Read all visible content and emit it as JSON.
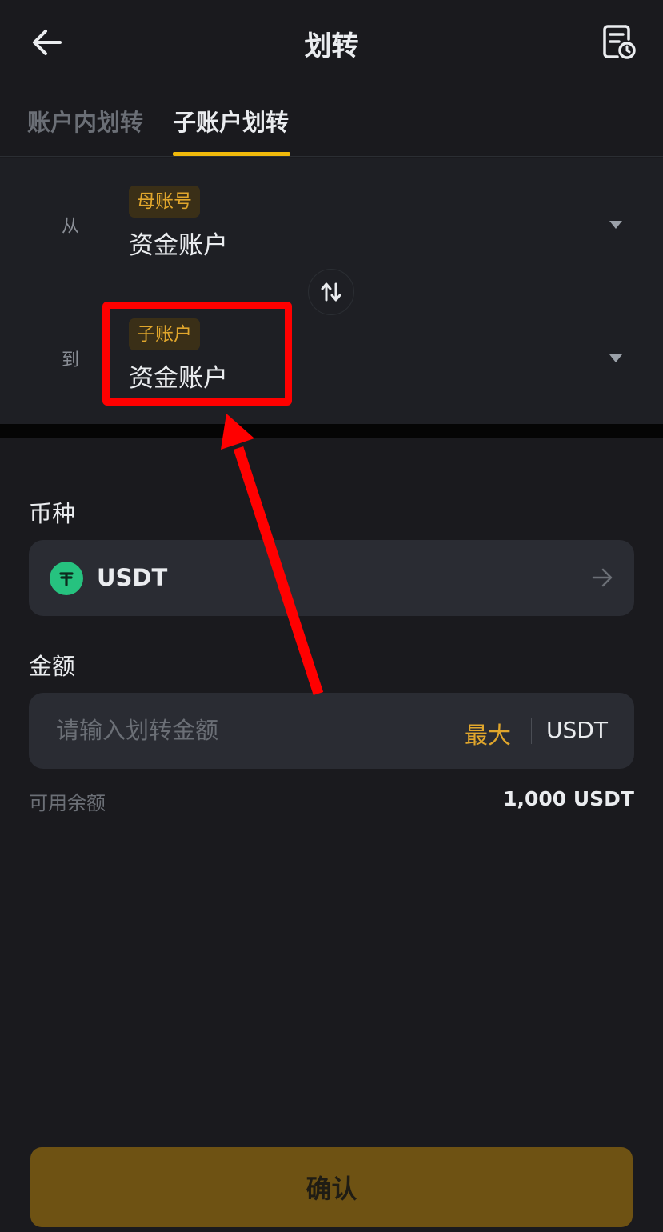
{
  "header": {
    "title": "划转",
    "back_icon": "arrow-left-icon",
    "history_icon": "history-record-icon"
  },
  "tabs": [
    {
      "label": "账户内划转",
      "active": false
    },
    {
      "label": "子账户划转",
      "active": true
    }
  ],
  "transfer": {
    "from": {
      "label": "从",
      "badge": "母账号",
      "account": "资金账户"
    },
    "to": {
      "label": "到",
      "badge": "子账户",
      "account": "资金账户"
    },
    "swap_icon": "swap-vertical-icon"
  },
  "coin": {
    "label": "币种",
    "symbol": "USDT",
    "icon": "tether-icon"
  },
  "amount": {
    "label": "金额",
    "placeholder": "请输入划转金额",
    "max_label": "最大",
    "unit": "USDT"
  },
  "available": {
    "label": "可用余额",
    "value": "1,000 USDT"
  },
  "confirm_label": "确认",
  "colors": {
    "background": "#1a1a1e",
    "accent": "#f0b90b",
    "badge_text": "#e0a62c",
    "highlight": "#ff0000",
    "confirm_button": "#6e5213",
    "coin_icon": "#26c27f"
  }
}
